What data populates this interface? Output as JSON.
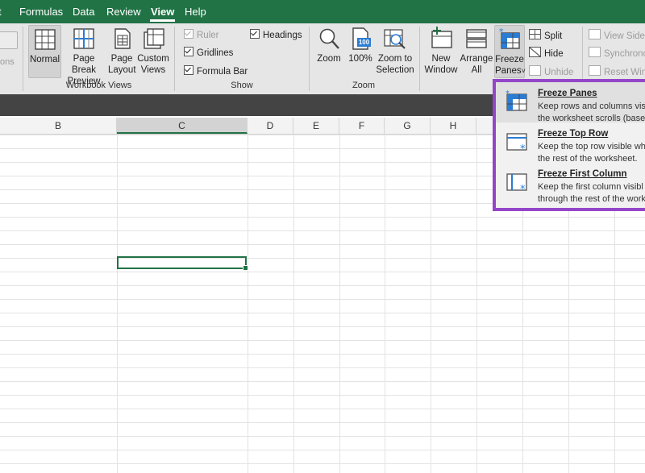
{
  "menu": {
    "tabs": [
      {
        "label": "t",
        "active": false
      },
      {
        "label": "Formulas",
        "active": false
      },
      {
        "label": "Data",
        "active": false
      },
      {
        "label": "Review",
        "active": false
      },
      {
        "label": "View",
        "active": true
      },
      {
        "label": "Help",
        "active": false
      }
    ]
  },
  "ribbon": {
    "partial_left_label": "ons",
    "workbook_views": {
      "label": "Workbook Views",
      "normal": "Normal",
      "page_break_1": "Page Break",
      "page_break_2": "Preview",
      "page_layout_1": "Page",
      "page_layout_2": "Layout",
      "custom_views_1": "Custom",
      "custom_views_2": "Views"
    },
    "show": {
      "label": "Show",
      "ruler": "Ruler",
      "gridlines": "Gridlines",
      "formula_bar": "Formula Bar",
      "headings": "Headings"
    },
    "zoom": {
      "label": "Zoom",
      "zoom": "Zoom",
      "hundred": "100%",
      "hundred_icon_text": "100",
      "zoom_selection_1": "Zoom to",
      "zoom_selection_2": "Selection"
    },
    "window": {
      "new_window_1": "New",
      "new_window_2": "Window",
      "arrange_all_1": "Arrange",
      "arrange_all_2": "All",
      "freeze_panes_1": "Freeze",
      "freeze_panes_2": "Panes",
      "freeze_caret": "˅",
      "split": "Split",
      "hide": "Hide",
      "unhide": "Unhide",
      "view_side": "View Side b",
      "synchronous": "Synchronou",
      "reset_window": "Reset Windo"
    }
  },
  "columns": [
    "B",
    "C",
    "D",
    "E",
    "F",
    "G",
    "H"
  ],
  "freeze_menu": {
    "items": [
      {
        "title": "Freeze Panes",
        "desc1": "Keep rows and columns visi",
        "desc2": "the worksheet scrolls (based"
      },
      {
        "title": "Freeze Top Row",
        "desc1": "Keep the top row visible wh",
        "desc2": "the rest of the worksheet."
      },
      {
        "title": "Freeze First Column",
        "desc1": "Keep the first column visibl",
        "desc2": "through the rest of the work"
      }
    ]
  },
  "colors": {
    "accent": "#217346",
    "highlight_border": "#9446c9",
    "icon_blue": "#2b7cd3"
  }
}
